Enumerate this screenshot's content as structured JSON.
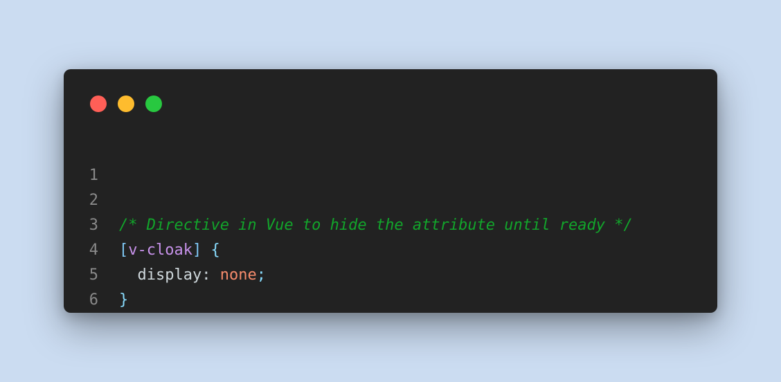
{
  "colors": {
    "background": "#cbdcf1",
    "window": "#222222",
    "dot_red": "#ff5f57",
    "dot_yellow": "#febc2e",
    "dot_green": "#28c840",
    "line_number": "#8a8a8a",
    "comment": "#12a52b",
    "bracket": "#7fc8f5",
    "selector": "#c792ea",
    "property": "#cfd8dc",
    "value": "#f78c6c",
    "punctuation": "#89ddff"
  },
  "window_controls": [
    "close-dot",
    "minimize-dot",
    "maximize-dot"
  ],
  "code": {
    "lines": [
      {
        "number": "1",
        "tokens": []
      },
      {
        "number": "2",
        "tokens": [
          {
            "text": "/* Directive in Vue to hide the attribute until ready */",
            "kind": "comment"
          }
        ]
      },
      {
        "number": "3",
        "tokens": [
          {
            "text": "[",
            "kind": "bracket"
          },
          {
            "text": "v-cloak",
            "kind": "selector"
          },
          {
            "text": "]",
            "kind": "bracket"
          },
          {
            "text": " ",
            "kind": "space"
          },
          {
            "text": "{",
            "kind": "punctuation"
          }
        ]
      },
      {
        "number": "4",
        "tokens": [
          {
            "text": "  display",
            "kind": "property"
          },
          {
            "text": ": ",
            "kind": "property"
          },
          {
            "text": "none",
            "kind": "value"
          },
          {
            "text": ";",
            "kind": "punctuation"
          }
        ]
      },
      {
        "number": "5",
        "tokens": [
          {
            "text": "}",
            "kind": "punctuation"
          }
        ]
      },
      {
        "number": "6",
        "tokens": []
      }
    ]
  }
}
